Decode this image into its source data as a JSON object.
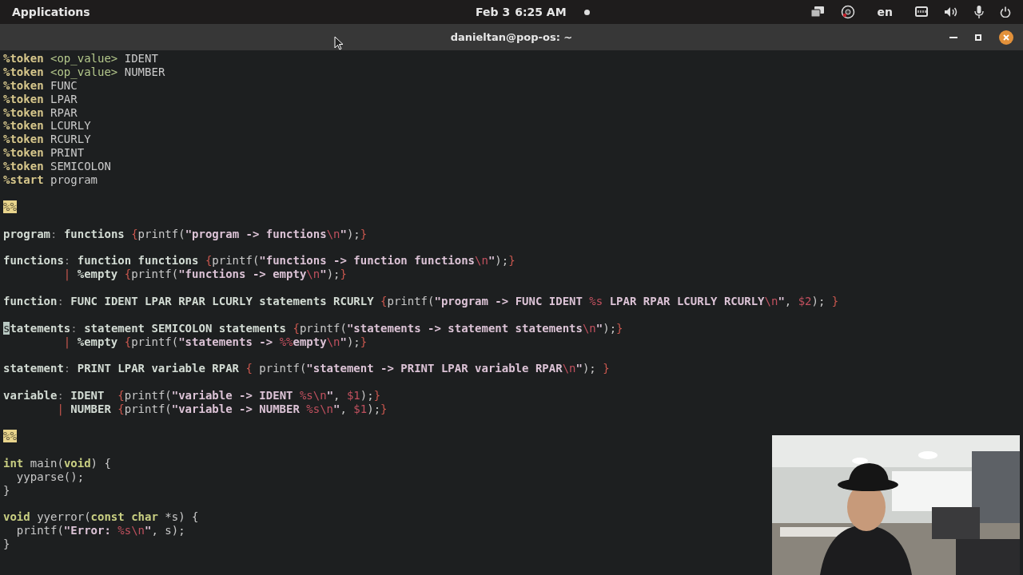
{
  "top_bar": {
    "menu": "Applications",
    "date": "Feb 3",
    "time": "6:25 AM",
    "language": "en"
  },
  "window": {
    "title": "danieltan@pop-os: ~"
  },
  "editor": {
    "blocks": [
      [
        [
          {
            "kind": "directive",
            "text": "%token "
          },
          {
            "kind": "type",
            "text": "<op_value>"
          },
          {
            "kind": "plain",
            "text": " IDENT"
          }
        ],
        [
          {
            "kind": "directive",
            "text": "%token "
          },
          {
            "kind": "type",
            "text": "<op_value>"
          },
          {
            "kind": "plain",
            "text": " NUMBER"
          }
        ],
        [
          {
            "kind": "directive",
            "text": "%token"
          },
          {
            "kind": "plain",
            "text": " FUNC"
          }
        ],
        [
          {
            "kind": "directive",
            "text": "%token"
          },
          {
            "kind": "plain",
            "text": " LPAR"
          }
        ],
        [
          {
            "kind": "directive",
            "text": "%token"
          },
          {
            "kind": "plain",
            "text": " RPAR"
          }
        ],
        [
          {
            "kind": "directive",
            "text": "%token"
          },
          {
            "kind": "plain",
            "text": " LCURLY"
          }
        ],
        [
          {
            "kind": "directive",
            "text": "%token"
          },
          {
            "kind": "plain",
            "text": " RCURLY"
          }
        ],
        [
          {
            "kind": "directive",
            "text": "%token"
          },
          {
            "kind": "plain",
            "text": " PRINT"
          }
        ],
        [
          {
            "kind": "directive",
            "text": "%token"
          },
          {
            "kind": "plain",
            "text": " SEMICOLON"
          }
        ],
        [
          {
            "kind": "directive",
            "text": "%start"
          },
          {
            "kind": "plain",
            "text": " program"
          }
        ]
      ],
      [
        [
          {
            "kind": "mark",
            "text": "%%"
          }
        ]
      ],
      [
        [
          {
            "kind": "rule",
            "text": "program"
          },
          {
            "kind": "colon",
            "text": ":"
          },
          {
            "kind": "rule",
            "text": " functions "
          },
          {
            "kind": "brace",
            "text": "{"
          },
          {
            "kind": "plain",
            "text": "printf("
          },
          {
            "kind": "string",
            "text": "\"program -> functions"
          },
          {
            "kind": "escape",
            "text": "\\n"
          },
          {
            "kind": "string",
            "text": "\""
          },
          {
            "kind": "plain",
            "text": ");"
          },
          {
            "kind": "brace",
            "text": "}"
          }
        ]
      ],
      [
        [
          {
            "kind": "rule",
            "text": "functions"
          },
          {
            "kind": "colon",
            "text": ":"
          },
          {
            "kind": "rule",
            "text": " function functions "
          },
          {
            "kind": "brace",
            "text": "{"
          },
          {
            "kind": "plain",
            "text": "printf("
          },
          {
            "kind": "string",
            "text": "\"functions -> function functions"
          },
          {
            "kind": "escape",
            "text": "\\n"
          },
          {
            "kind": "string",
            "text": "\""
          },
          {
            "kind": "plain",
            "text": ");"
          },
          {
            "kind": "brace",
            "text": "}"
          }
        ],
        [
          {
            "kind": "pipe",
            "text": "         |"
          },
          {
            "kind": "rule",
            "text": " %empty "
          },
          {
            "kind": "brace",
            "text": "{"
          },
          {
            "kind": "plain",
            "text": "printf("
          },
          {
            "kind": "string",
            "text": "\"functions -> empty"
          },
          {
            "kind": "escape",
            "text": "\\n"
          },
          {
            "kind": "string",
            "text": "\""
          },
          {
            "kind": "plain",
            "text": ");"
          },
          {
            "kind": "brace",
            "text": "}"
          }
        ]
      ],
      [
        [
          {
            "kind": "rule",
            "text": "function"
          },
          {
            "kind": "colon",
            "text": ":"
          },
          {
            "kind": "rule",
            "text": " FUNC IDENT LPAR RPAR LCURLY statements RCURLY "
          },
          {
            "kind": "brace",
            "text": "{"
          },
          {
            "kind": "plain",
            "text": "printf("
          },
          {
            "kind": "string",
            "text": "\"program -> FUNC IDENT "
          },
          {
            "kind": "escape",
            "text": "%s"
          },
          {
            "kind": "string",
            "text": " LPAR RPAR LCURLY RCURLY"
          },
          {
            "kind": "escape",
            "text": "\\n"
          },
          {
            "kind": "string",
            "text": "\""
          },
          {
            "kind": "plain",
            "text": ", "
          },
          {
            "kind": "escape",
            "text": "$2"
          },
          {
            "kind": "plain",
            "text": "); "
          },
          {
            "kind": "brace",
            "text": "}"
          }
        ]
      ],
      [
        [
          {
            "kind": "cursor",
            "text": "s"
          },
          {
            "kind": "rule",
            "text": "tatements"
          },
          {
            "kind": "colon",
            "text": ":"
          },
          {
            "kind": "rule",
            "text": " statement SEMICOLON statements "
          },
          {
            "kind": "brace",
            "text": "{"
          },
          {
            "kind": "plain",
            "text": "printf("
          },
          {
            "kind": "string",
            "text": "\"statements -> statement statements"
          },
          {
            "kind": "escape",
            "text": "\\n"
          },
          {
            "kind": "string",
            "text": "\""
          },
          {
            "kind": "plain",
            "text": ");"
          },
          {
            "kind": "brace",
            "text": "}"
          }
        ],
        [
          {
            "kind": "pipe",
            "text": "         |"
          },
          {
            "kind": "rule",
            "text": " %empty "
          },
          {
            "kind": "brace",
            "text": "{"
          },
          {
            "kind": "plain",
            "text": "printf("
          },
          {
            "kind": "string",
            "text": "\"statements -> "
          },
          {
            "kind": "escape",
            "text": "%%"
          },
          {
            "kind": "string",
            "text": "empty"
          },
          {
            "kind": "escape",
            "text": "\\n"
          },
          {
            "kind": "string",
            "text": "\""
          },
          {
            "kind": "plain",
            "text": ");"
          },
          {
            "kind": "brace",
            "text": "}"
          }
        ]
      ],
      [
        [
          {
            "kind": "rule",
            "text": "statement"
          },
          {
            "kind": "colon",
            "text": ":"
          },
          {
            "kind": "rule",
            "text": " PRINT LPAR variable RPAR "
          },
          {
            "kind": "brace",
            "text": "{"
          },
          {
            "kind": "plain",
            "text": " printf("
          },
          {
            "kind": "string",
            "text": "\"statement -> PRINT LPAR variable RPAR"
          },
          {
            "kind": "escape",
            "text": "\\n"
          },
          {
            "kind": "string",
            "text": "\""
          },
          {
            "kind": "plain",
            "text": "); "
          },
          {
            "kind": "brace",
            "text": "}"
          }
        ]
      ],
      [
        [
          {
            "kind": "rule",
            "text": "variable"
          },
          {
            "kind": "colon",
            "text": ":"
          },
          {
            "kind": "rule",
            "text": " IDENT  "
          },
          {
            "kind": "brace",
            "text": "{"
          },
          {
            "kind": "plain",
            "text": "printf("
          },
          {
            "kind": "string",
            "text": "\"variable -> IDENT "
          },
          {
            "kind": "escape",
            "text": "%s\\n"
          },
          {
            "kind": "string",
            "text": "\""
          },
          {
            "kind": "plain",
            "text": ", "
          },
          {
            "kind": "escape",
            "text": "$1"
          },
          {
            "kind": "plain",
            "text": ");"
          },
          {
            "kind": "brace",
            "text": "}"
          }
        ],
        [
          {
            "kind": "pipe",
            "text": "        |"
          },
          {
            "kind": "rule",
            "text": " NUMBER "
          },
          {
            "kind": "brace",
            "text": "{"
          },
          {
            "kind": "plain",
            "text": "printf("
          },
          {
            "kind": "string",
            "text": "\"variable -> NUMBER "
          },
          {
            "kind": "escape",
            "text": "%s\\n"
          },
          {
            "kind": "string",
            "text": "\""
          },
          {
            "kind": "plain",
            "text": ", "
          },
          {
            "kind": "escape",
            "text": "$1"
          },
          {
            "kind": "plain",
            "text": ");"
          },
          {
            "kind": "brace",
            "text": "}"
          }
        ]
      ],
      [
        [
          {
            "kind": "mark",
            "text": "%%"
          }
        ]
      ],
      [
        [
          {
            "kind": "keyword",
            "text": "int"
          },
          {
            "kind": "plain",
            "text": " main("
          },
          {
            "kind": "keyword",
            "text": "void"
          },
          {
            "kind": "plain",
            "text": ") {"
          }
        ],
        [
          {
            "kind": "plain",
            "text": "  yyparse();"
          }
        ],
        [
          {
            "kind": "plain",
            "text": "}"
          }
        ]
      ],
      [
        [
          {
            "kind": "keyword",
            "text": "void"
          },
          {
            "kind": "plain",
            "text": " yyerror("
          },
          {
            "kind": "keyword",
            "text": "const char"
          },
          {
            "kind": "plain",
            "text": " *s) {"
          }
        ],
        [
          {
            "kind": "plain",
            "text": "  printf("
          },
          {
            "kind": "string",
            "text": "\"Error: "
          },
          {
            "kind": "escape",
            "text": "%s\\n"
          },
          {
            "kind": "string",
            "text": "\""
          },
          {
            "kind": "plain",
            "text": ", s);"
          }
        ],
        [
          {
            "kind": "plain",
            "text": "}"
          }
        ]
      ]
    ]
  }
}
